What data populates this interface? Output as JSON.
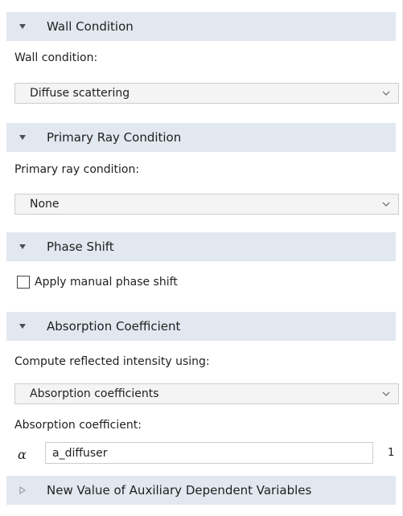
{
  "sections": [
    {
      "title": "Wall Condition",
      "expanded": true
    },
    {
      "title": "Primary Ray Condition",
      "expanded": true
    },
    {
      "title": "Phase Shift",
      "expanded": true
    },
    {
      "title": "Absorption Coefficient",
      "expanded": true
    },
    {
      "title": "New Value of Auxiliary Dependent Variables",
      "expanded": false
    }
  ],
  "wall_condition": {
    "label": "Wall condition:",
    "value": "Diffuse scattering"
  },
  "primary_ray": {
    "label": "Primary ray condition:",
    "value": "None"
  },
  "phase_shift": {
    "checkbox_label": "Apply manual phase shift",
    "checked": false
  },
  "absorption": {
    "compute_label": "Compute reflected intensity using:",
    "compute_value": "Absorption coefficients",
    "coef_label": "Absorption coefficient:",
    "symbol": "α",
    "coef_value": "a_diffuser",
    "unit": "1"
  },
  "colors": {
    "header_bg": "#e2e8f0",
    "dropdown_bg": "#f4f4f4",
    "border": "#c9cdd2"
  },
  "icons": {
    "expanded": "triangle-down-icon",
    "collapsed": "triangle-right-icon",
    "dropdown": "chevron-down-icon"
  }
}
